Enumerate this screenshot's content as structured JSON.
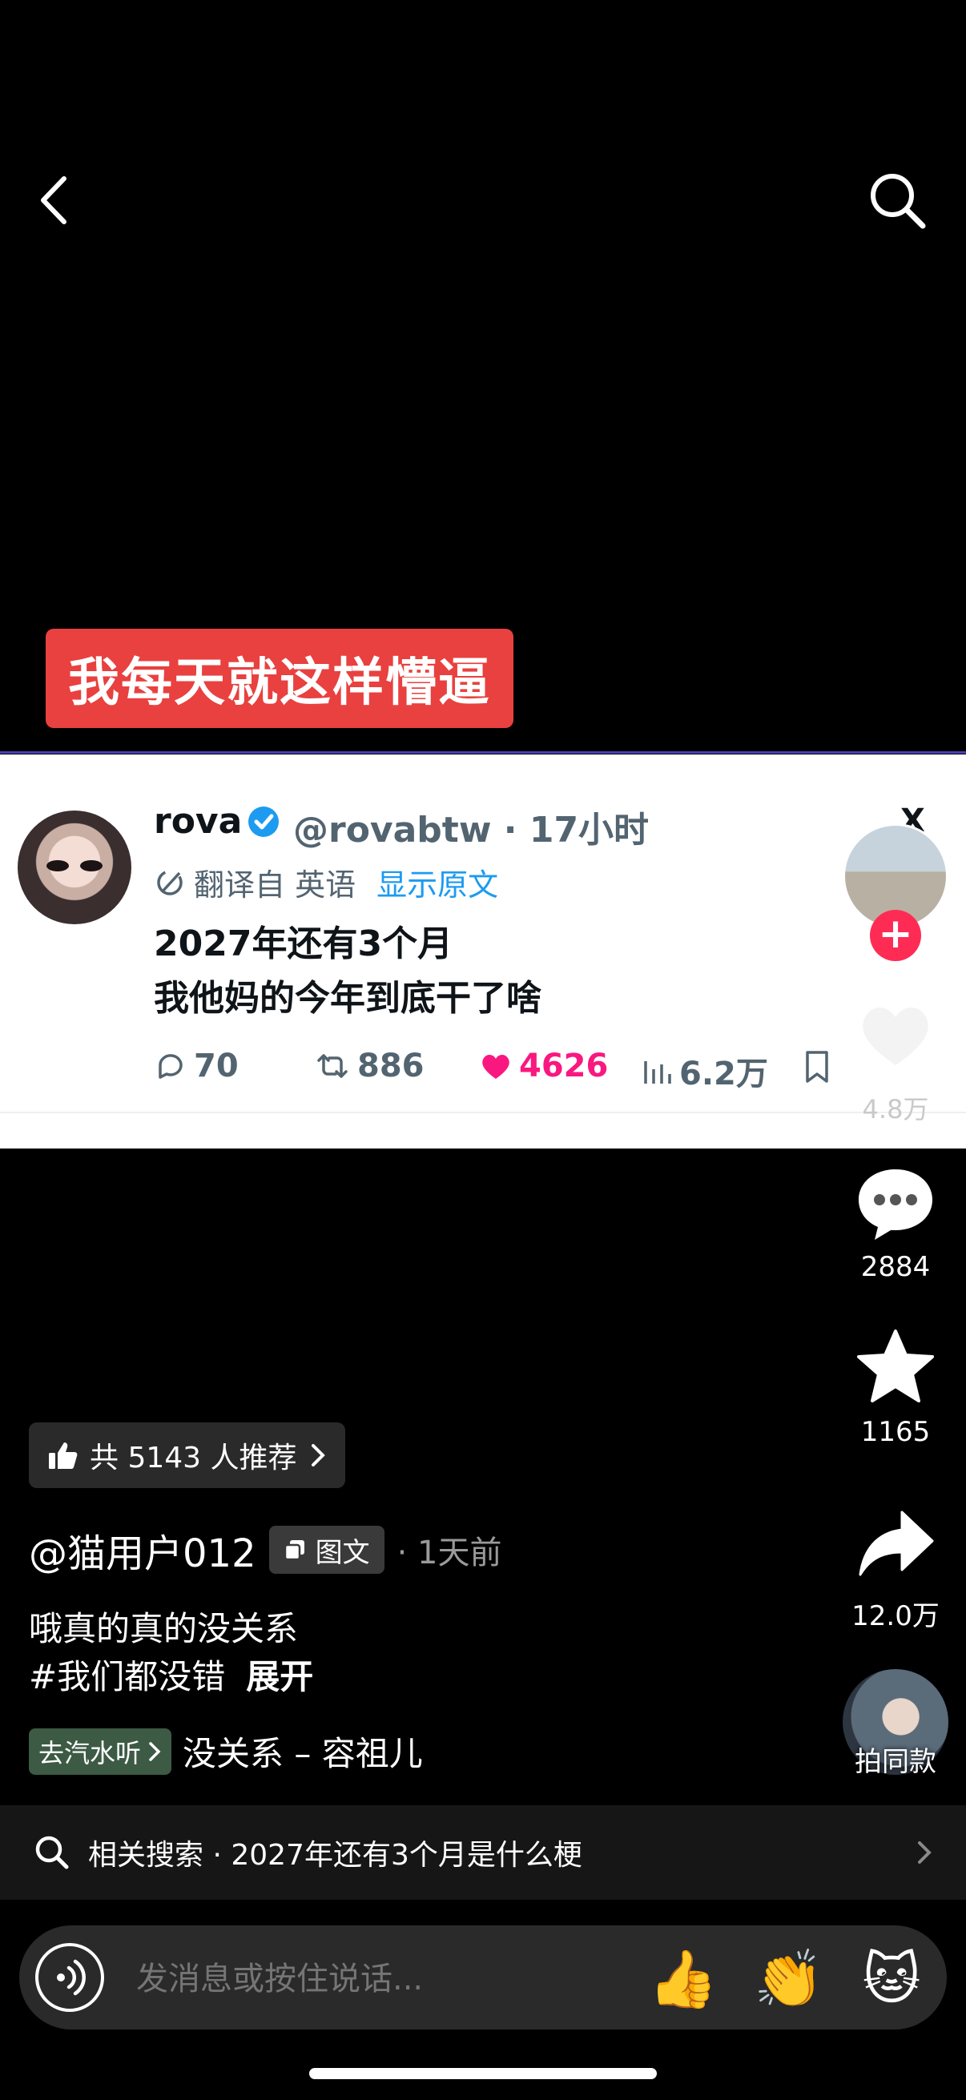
{
  "caption": "我每天就这样懵逼",
  "tweet": {
    "name": "rova",
    "handle": "@rovabtw · 17小时",
    "translated_from": "翻译自 英语",
    "show_original": "显示原文",
    "text_line1": "2027年还有3个月",
    "text_line2": "我他妈的今年到底干了啥",
    "replies": "70",
    "retweets": "886",
    "likes": "4626",
    "views": "6.2万",
    "x_logo": "X"
  },
  "rail": {
    "like_count": "4.8万",
    "comment_count": "2884",
    "favorite_count": "1165",
    "share_count": "12.0万",
    "music_label": "拍同款"
  },
  "recommend": "共 5143 人推荐",
  "author": {
    "name": "@猫用户012",
    "tag": "图文",
    "time": "· 1天前"
  },
  "description": {
    "line1": "哦真的真的没关系",
    "hashtag": "#我们都没错",
    "expand": "展开"
  },
  "music": {
    "app_button": "去汽水听",
    "song": "没关系 – 容祖儿"
  },
  "related_search": "相关搜索 · 2027年还有3个月是什么梗",
  "input": {
    "placeholder": "发消息或按住说话..."
  },
  "emojis": [
    "👍",
    "👏",
    "🐱"
  ],
  "colors": {
    "caption_bg": "#e8413f",
    "like_pink": "#f91880",
    "follow_red": "#fe2c55",
    "link_blue": "#1d9bf0"
  }
}
